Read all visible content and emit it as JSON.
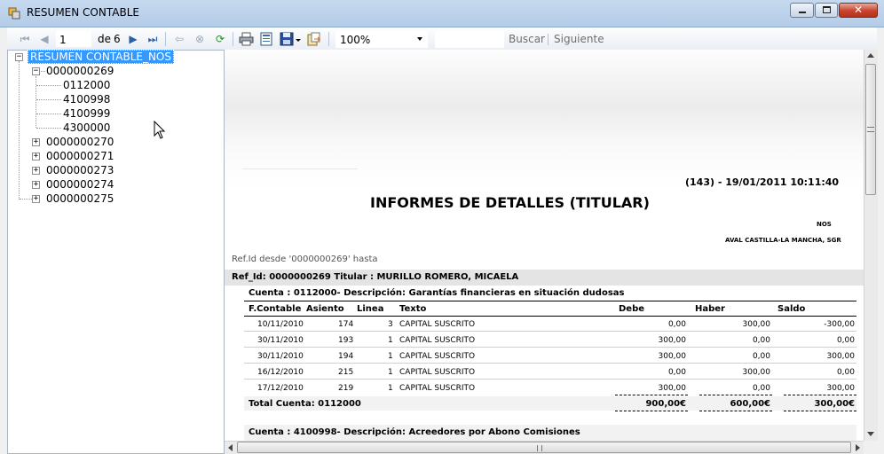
{
  "window": {
    "title": "RESUMEN CONTABLE"
  },
  "toolbar": {
    "page_value": "1",
    "of_label": "de",
    "total_pages": "6",
    "zoom": "100%",
    "search_label": "Buscar",
    "next_label": "Siguiente"
  },
  "tree": {
    "root": "RESUMEN CONTABLE_NOS",
    "expanded": {
      "label": "0000000269",
      "children": [
        "0112000",
        "4100998",
        "4100999",
        "4300000"
      ]
    },
    "collapsed": [
      "0000000270",
      "0000000271",
      "0000000273",
      "0000000274",
      "0000000275"
    ]
  },
  "report": {
    "stamp": "(143) - 19/01/2011 10:11:40",
    "heading": "INFORMES DE DETALLES (TITULAR)",
    "company": "NOS",
    "organization": "AVAL CASTILLA-LA MANCHA, SGR",
    "filter": "Ref.Id desde '0000000269' hasta",
    "ref_line": "Ref_Id: 0000000269   Titular : MURILLO ROMERO, MICAELA",
    "cuenta1": "Cuenta : 0112000- Descripción: Garantías financieras en situación dudosas",
    "columns": [
      "F.Contable",
      "Asiento",
      "Linea",
      "Texto",
      "Debe",
      "Haber",
      "Saldo"
    ],
    "rows": [
      [
        "10/11/2010",
        "174",
        "3",
        "CAPITAL SUSCRITO",
        "0,00",
        "300,00",
        "-300,00"
      ],
      [
        "30/11/2010",
        "193",
        "1",
        "CAPITAL SUSCRITO",
        "300,00",
        "0,00",
        "0,00"
      ],
      [
        "30/11/2010",
        "194",
        "1",
        "CAPITAL SUSCRITO",
        "300,00",
        "0,00",
        "300,00"
      ],
      [
        "16/12/2010",
        "215",
        "1",
        "CAPITAL SUSCRITO",
        "0,00",
        "300,00",
        "0,00"
      ],
      [
        "17/12/2010",
        "219",
        "1",
        "CAPITAL SUSCRITO",
        "300,00",
        "0,00",
        "300,00"
      ]
    ],
    "total_label": "Total Cuenta: 0112000",
    "total_debe": "900,00€",
    "total_haber": "600,00€",
    "total_saldo": "300,00€",
    "cuenta2": "Cuenta : 4100998- Descripción: Acreedores por Abono Comisiones"
  },
  "icons": [
    "app-icon",
    "first-page-icon",
    "prev-page-icon",
    "next-page-icon",
    "last-page-icon",
    "back-icon",
    "stop-icon",
    "refresh-icon",
    "print-icon",
    "page-layout-icon",
    "save-icon",
    "export-icon",
    "cursor-icon"
  ]
}
